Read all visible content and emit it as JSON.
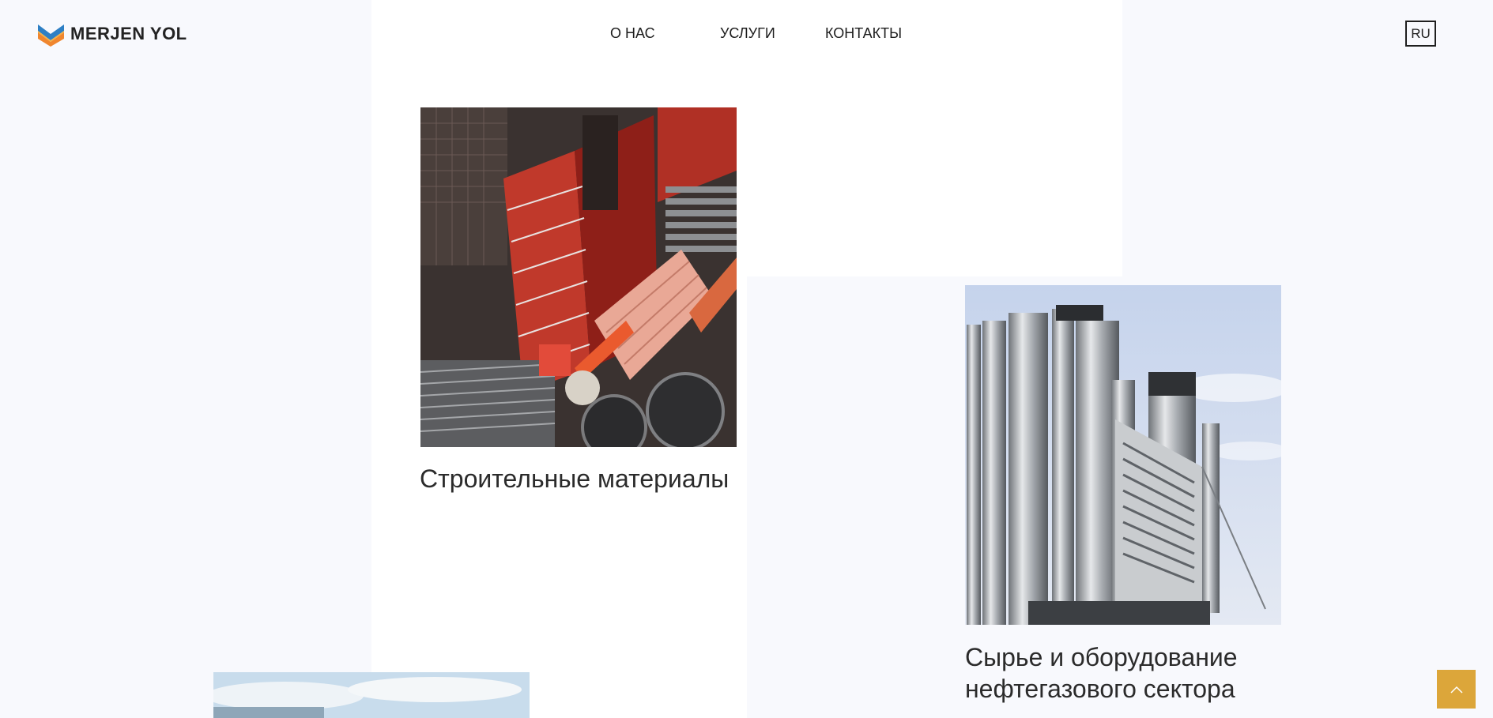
{
  "header": {
    "logo_text": "MERJEN YOL",
    "nav": {
      "about": "О НАС",
      "services": "УСЛУГИ",
      "contacts": "КОНТАКТЫ"
    },
    "language": "RU"
  },
  "cards": [
    {
      "title": "Строительные материалы",
      "image": "construction-site-photo"
    },
    {
      "title": "Сырье и оборудование нефтегазового сектора",
      "image": "industrial-chimneys-photo"
    },
    {
      "image": "sky-photo"
    }
  ],
  "icons": {
    "logo": "merjen-yol-logo-icon",
    "scroll_top": "chevron-up-icon"
  },
  "colors": {
    "page_background": "#f8f9fd",
    "panel_background": "#ffffff",
    "accent": "#dca63a",
    "logo_orange": "#f0862e",
    "logo_blue": "#2d7fc4",
    "text": "#2b2b2b"
  }
}
